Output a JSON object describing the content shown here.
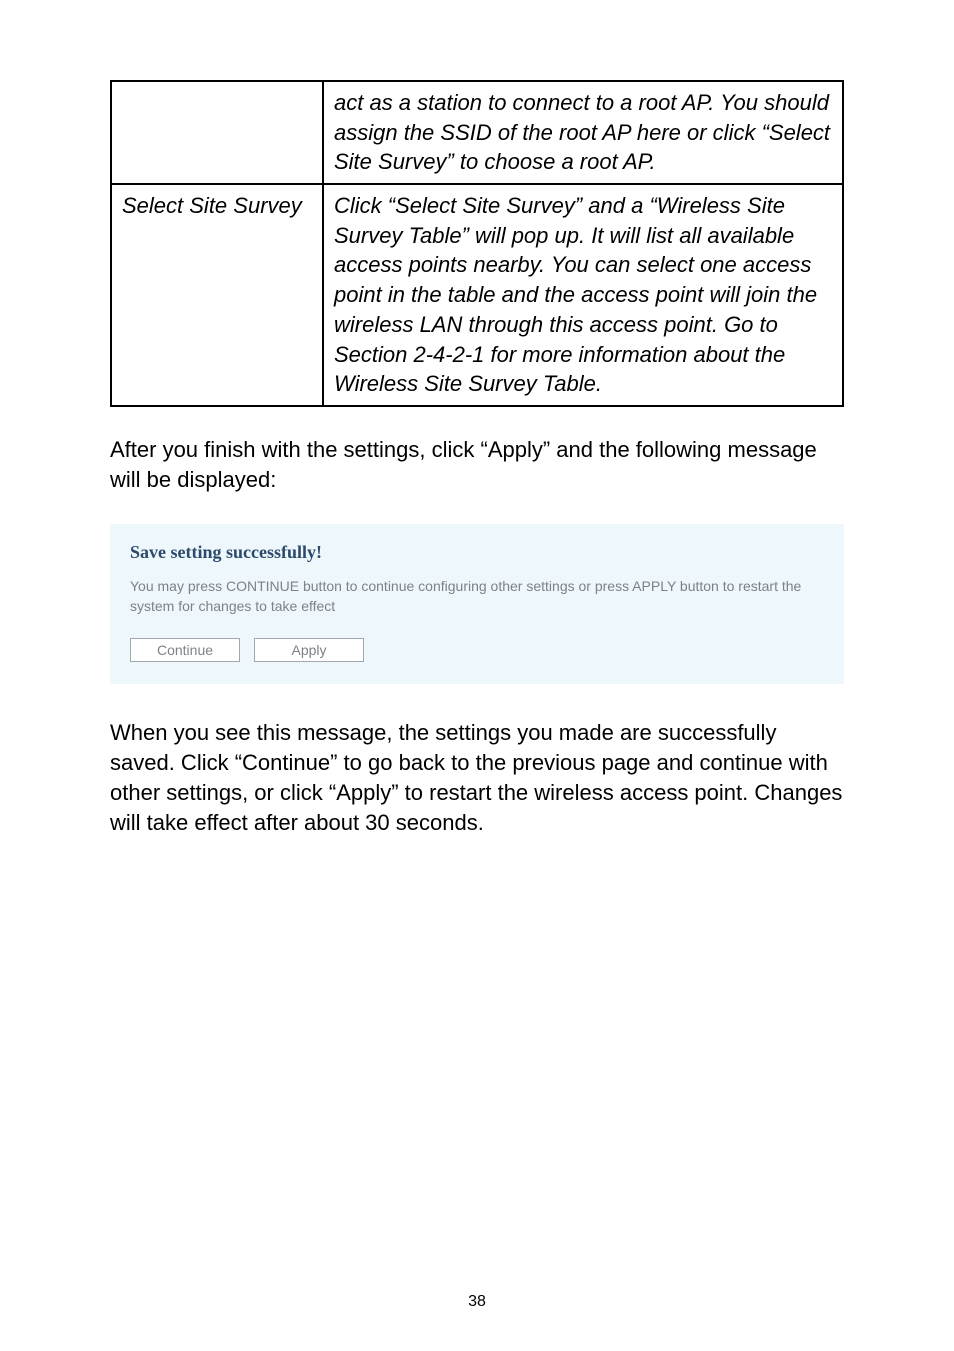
{
  "table": {
    "row1": {
      "col1": "",
      "col2": "act as a station to connect to a root AP. You should assign the SSID of the root AP here or click “Select Site Survey” to choose a root AP."
    },
    "row2": {
      "col1": "Select Site Survey",
      "col2": "Click “Select Site Survey” and a “Wireless Site Survey Table” will pop up. It will list all available access points nearby. You can select one access point in the table and the access point will join the wireless LAN through this access point. Go to Section 2-4-2-1 for more information about the Wireless Site Survey Table."
    }
  },
  "paragraph1": "After you finish with the settings, click “Apply” and the following message will be displayed:",
  "callout": {
    "title": "Save setting successfully!",
    "body": "You may press CONTINUE button to continue configuring other settings or press APPLY button to restart the system for changes to take effect",
    "continue_label": "Continue",
    "apply_label": "Apply"
  },
  "paragraph2": "When you see this message, the settings you made are successfully saved. Click “Continue” to go back to the previous page and continue with other settings, or click “Apply” to restart the wireless access point. Changes will take effect after about 30 seconds.",
  "page_number": "38"
}
